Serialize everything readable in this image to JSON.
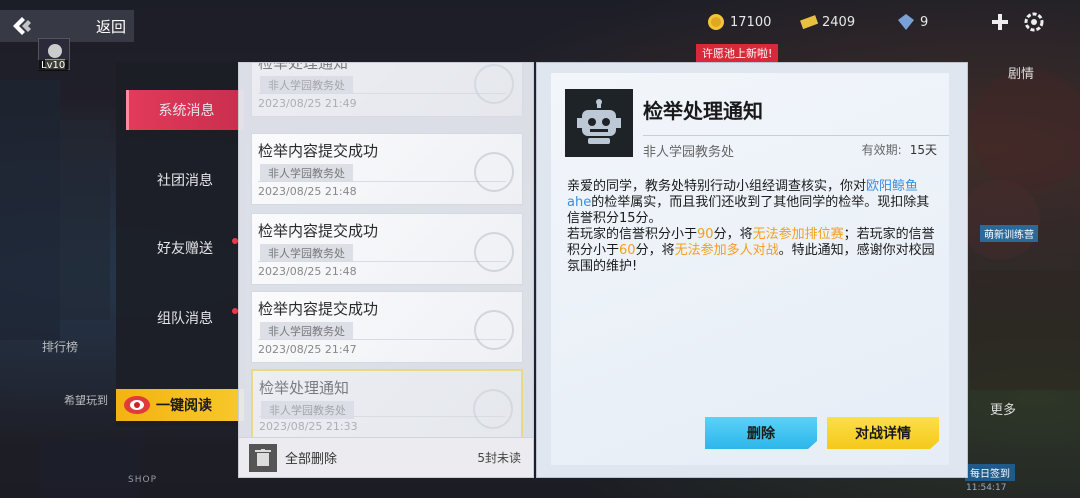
{
  "topbar": {
    "back_label": "返回",
    "level": "Lv10",
    "resources": [
      {
        "icon": "coin-icon",
        "value": "17100"
      },
      {
        "icon": "ticket-icon",
        "value": "2409"
      },
      {
        "icon": "gem-icon",
        "value": "9"
      }
    ],
    "banner_tag": "许愿池上新啦!"
  },
  "background": {
    "right_label": "剧情",
    "more_label": "更多",
    "rank_label": "排行榜",
    "hope_label": "希望玩到",
    "shop_label": "SHOP",
    "newbie_label": "萌新训练营",
    "daily_label": "每日签到",
    "clock": "11:54:17"
  },
  "tabs": [
    {
      "label": "系统消息",
      "active": true,
      "dot": false
    },
    {
      "label": "社团消息",
      "active": false,
      "dot": false
    },
    {
      "label": "好友赠送",
      "active": false,
      "dot": true
    },
    {
      "label": "组队消息",
      "active": false,
      "dot": true
    }
  ],
  "read_all_label": "一键阅读",
  "messages": [
    {
      "title": "检举处理通知",
      "from": "非人学园教务处",
      "date": "2023/08/25 21:49",
      "read": true,
      "selected": false
    },
    {
      "title": "检举内容提交成功",
      "from": "非人学园教务处",
      "date": "2023/08/25 21:48",
      "read": false,
      "selected": false
    },
    {
      "title": "检举内容提交成功",
      "from": "非人学园教务处",
      "date": "2023/08/25 21:48",
      "read": false,
      "selected": false
    },
    {
      "title": "检举内容提交成功",
      "from": "非人学园教务处",
      "date": "2023/08/25 21:47",
      "read": false,
      "selected": false
    },
    {
      "title": "检举处理通知",
      "from": "非人学园教务处",
      "date": "2023/08/25 21:33",
      "read": true,
      "selected": true
    }
  ],
  "list_footer": {
    "delete_all_label": "全部删除",
    "unread_count": "5封未读"
  },
  "detail": {
    "title": "检举处理通知",
    "from": "非人学园教务处",
    "validity_label": "有效期:",
    "validity_value": "15天",
    "body": {
      "p1a": "亲爱的同学，教务处特别行动小组经调查核实，你对",
      "p1_name": "欧阳鲸鱼ahe",
      "p1b": "的检举属实，而且我们还收到了其他同学的检举。现扣除其信誉积分15分。",
      "p2a": "若玩家的信誉积分小于",
      "p2_n1": "90",
      "p2b": "分，将",
      "p2_r1": "无法参加排位赛",
      "p2c": "；若玩家的信誉积分小于",
      "p2_n2": "60",
      "p2d": "分，将",
      "p2_r2": "无法参加多人对战",
      "p2e": "。特此通知，感谢你对校园氛围的维护!"
    },
    "delete_label": "删除",
    "battle_label": "对战详情"
  },
  "colors": {
    "tab_active": "#e23a5a",
    "read_all": "#f5bd1a",
    "delete_btn": "#3cc4f0",
    "battle_btn": "#f8d22a",
    "highlight_blue": "#3a8ee0",
    "highlight_orange": "#f0a020"
  }
}
